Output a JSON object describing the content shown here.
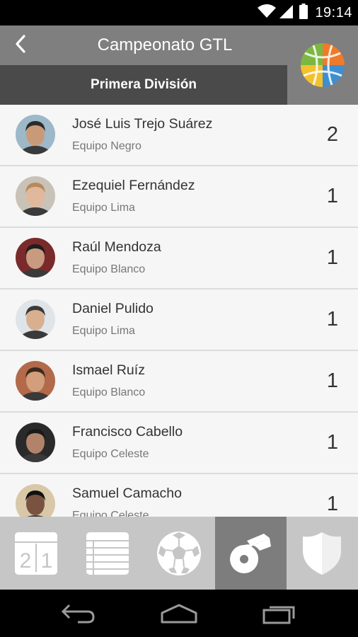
{
  "status_bar": {
    "time": "19:14"
  },
  "header": {
    "title": "Campeonato GTL",
    "division": "Primera División"
  },
  "players": [
    {
      "name": "José Luis Trejo Suárez",
      "team": "Equipo Negro",
      "goals": "2",
      "skin": "#c99a78",
      "hair": "#2b2b2b",
      "bg": "#9db8c8"
    },
    {
      "name": "Ezequiel Fernández",
      "team": "Equipo Lima",
      "goals": "1",
      "skin": "#e0b99c",
      "hair": "#b88a5a",
      "bg": "#c9c2b8"
    },
    {
      "name": "Raúl Mendoza",
      "team": "Equipo Blanco",
      "goals": "1",
      "skin": "#c89a80",
      "hair": "#1e1e1e",
      "bg": "#7a2a2a"
    },
    {
      "name": "Daniel Pulido",
      "team": "Equipo Lima",
      "goals": "1",
      "skin": "#d8b090",
      "hair": "#3a3a3a",
      "bg": "#dfe4e8"
    },
    {
      "name": "Ismael Ruíz",
      "team": "Equipo Blanco",
      "goals": "1",
      "skin": "#d39e7c",
      "hair": "#3b2a20",
      "bg": "#b26a4a"
    },
    {
      "name": "Francisco Cabello",
      "team": "Equipo Celeste",
      "goals": "1",
      "skin": "#b0836a",
      "hair": "#1a1a1a",
      "bg": "#2a2a2a"
    },
    {
      "name": "Samuel Camacho",
      "team": "Equipo Celeste",
      "goals": "1",
      "skin": "#7a5240",
      "hair": "#111111",
      "bg": "#d8c8a8"
    }
  ],
  "tabs": [
    {
      "icon": "scoreboard-icon",
      "label": "21"
    },
    {
      "icon": "standings-table-icon"
    },
    {
      "icon": "soccer-ball-icon"
    },
    {
      "icon": "whistle-icon",
      "active": true
    },
    {
      "icon": "shield-icon"
    }
  ],
  "colors": {
    "app_bar": "#7f7f7f",
    "division_bar": "#4a4a4a",
    "list_bg": "#f6f6f6",
    "tabs_bg": "#c6c6c6",
    "tab_active": "#7d7d7d"
  }
}
